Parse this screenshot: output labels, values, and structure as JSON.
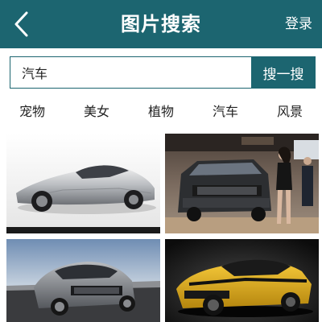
{
  "header": {
    "title": "图片搜索",
    "login_label": "登录",
    "back_icon": "chevron-left-icon",
    "background_color": "#1c6570"
  },
  "search": {
    "query": "汽车",
    "button_label": "搜一搜"
  },
  "categories": [
    {
      "label": "宠物"
    },
    {
      "label": "美女"
    },
    {
      "label": "植物"
    },
    {
      "label": "汽车"
    },
    {
      "label": "风景"
    }
  ],
  "results": [
    {
      "image": "silver-sports-car"
    },
    {
      "image": "dark-suv-with-model-at-auto-show"
    },
    {
      "image": "grey-sedan-on-road"
    },
    {
      "image": "yellow-sports-car"
    }
  ]
}
